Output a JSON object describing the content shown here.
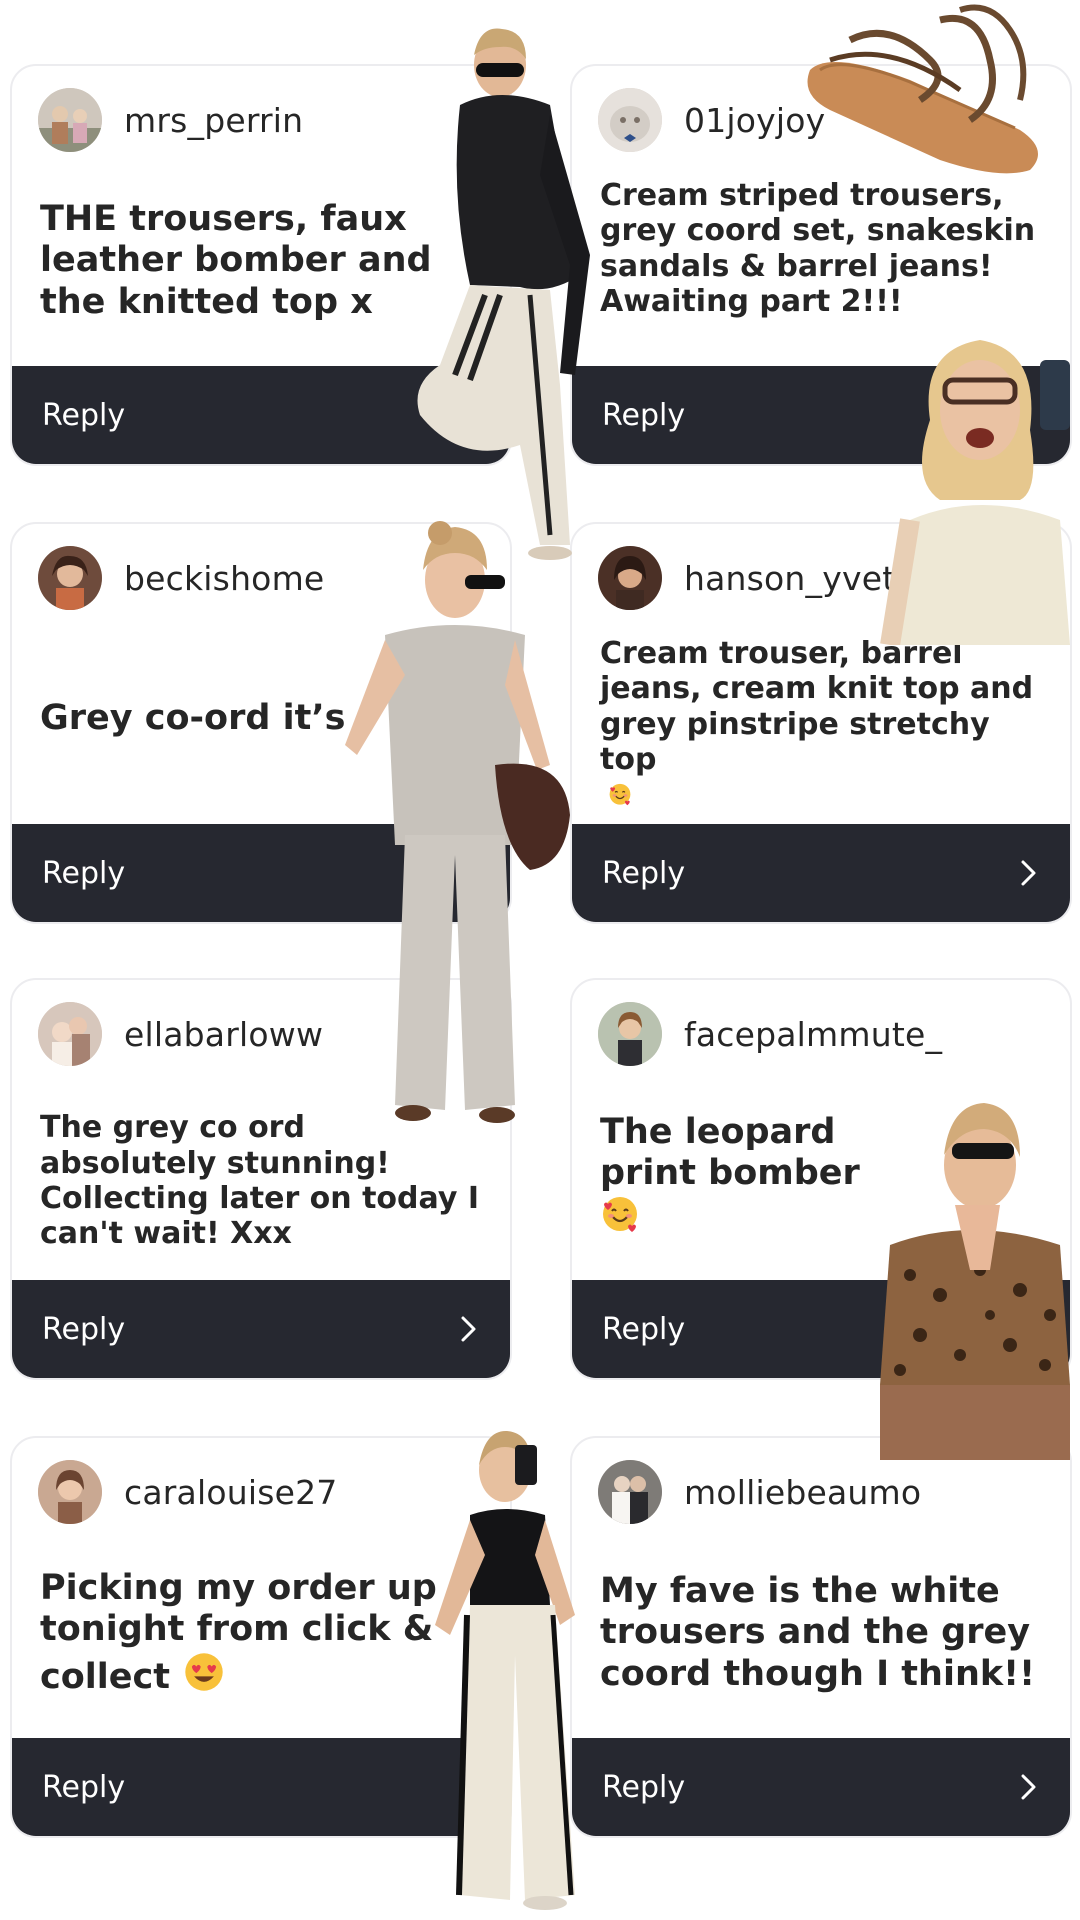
{
  "comments": [
    {
      "username": "mrs_perrin",
      "text": "THE trousers, faux leather bomber and the knitted top x",
      "reply_label": "Reply",
      "avatar_color": "#9c8f86"
    },
    {
      "username": "01joyjoy",
      "text": "Cream striped trousers, grey coord set, snakeskin sandals & barrel jeans! Awaiting part 2!!!",
      "reply_label": "Reply",
      "avatar_color": "#d8d2cc"
    },
    {
      "username": "beckishome",
      "text": "Grey co-ord it’s",
      "reply_label": "Reply",
      "avatar_color": "#7a4d3d"
    },
    {
      "username": "hanson_yvett",
      "text": "Cream trouser, barrel jeans, cream knit top and grey pinstripe stretchy top",
      "emoji": "smiling-face-with-hearts",
      "reply_label": "Reply",
      "avatar_color": "#5b3b2e"
    },
    {
      "username": "ellabarloww",
      "text": "The grey co ord absolutely stunning! Collecting later on today I can't wait! Xxx",
      "reply_label": "Reply",
      "avatar_color": "#b89a8a"
    },
    {
      "username": "facepalmmute_",
      "text": "The leopard print bomber",
      "emoji": "smiling-face-with-hearts",
      "reply_label": "Reply",
      "avatar_color": "#c49a72"
    },
    {
      "username": "caralouise27",
      "text": "Picking my order up tonight from click & collect",
      "emoji": "heart-eyes",
      "reply_label": "Reply",
      "avatar_color": "#a57b66"
    },
    {
      "username": "molliebeaumo",
      "text": "My fave is the white trousers and the grey coord though I think!!",
      "reply_label": "Reply",
      "avatar_color": "#8d8a86"
    }
  ],
  "colors": {
    "reply_bar": "#262830",
    "card_border": "#ececef",
    "text": "#262626"
  },
  "icons": [
    "chevron-right-icon",
    "avatar-photo",
    "smiling-face-with-hearts-emoji",
    "heart-eyes-emoji"
  ]
}
